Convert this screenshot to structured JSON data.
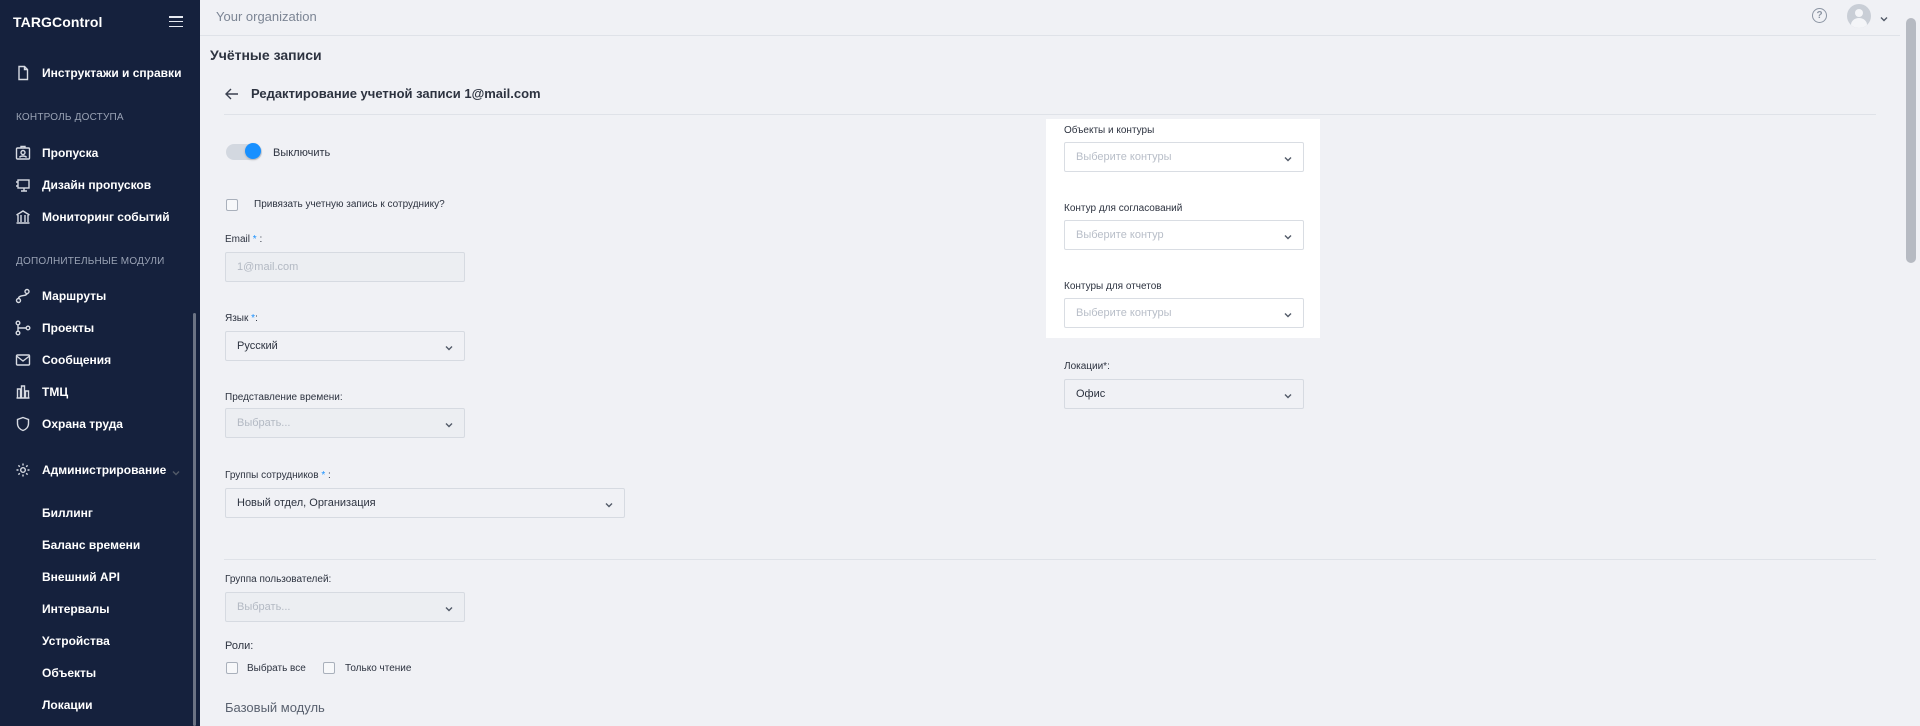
{
  "app": {
    "logo": "TARGControl"
  },
  "header": {
    "org_name": "Your organization",
    "help_glyph": "?"
  },
  "sidebar": {
    "items_top": [
      {
        "label": "Инструктажи и справки",
        "icon": "document-icon"
      }
    ],
    "section_access": "КОНТРОЛЬ ДОСТУПА",
    "items_access": [
      {
        "label": "Пропуска",
        "icon": "badge-icon"
      },
      {
        "label": "Дизайн пропусков",
        "icon": "design-icon"
      },
      {
        "label": "Мониторинг событий",
        "icon": "monitor-icon"
      }
    ],
    "section_modules": "ДОПОЛНИТЕЛЬНЫЕ МОДУЛИ",
    "items_modules": [
      {
        "label": "Маршруты",
        "icon": "route-icon"
      },
      {
        "label": "Проекты",
        "icon": "projects-icon"
      },
      {
        "label": "Сообщения",
        "icon": "mail-icon"
      },
      {
        "label": "ТМЦ",
        "icon": "inventory-icon"
      },
      {
        "label": "Охрана труда",
        "icon": "shield-icon"
      }
    ],
    "admin": {
      "label": "Администрирование",
      "icon": "gear-icon"
    },
    "admin_sub": [
      "Биллинг",
      "Баланс времени",
      "Внешний API",
      "Интервалы",
      "Устройства",
      "Объекты",
      "Локации"
    ]
  },
  "page": {
    "title": "Учётные записи",
    "edit_title": "Редактирование учетной записи 1@mail.com"
  },
  "form": {
    "toggle_label": "Выключить",
    "toggle_on": true,
    "link_employee_label": "Привязать учетную запись к сотруднику?",
    "email_label": "Email",
    "email_required": "*",
    "email_colon": " :",
    "email_value": "1@mail.com",
    "language_label": "Язык",
    "language_required": "*",
    "language_colon": ":",
    "language_value": "Русский",
    "time_label": "Представление времени:",
    "time_placeholder": "Выбрать...",
    "groups_label": "Группы сотрудников",
    "groups_required": "*",
    "groups_colon": " :",
    "groups_value": "Новый отдел, Организация",
    "user_group_label": "Группа пользователей:",
    "user_group_placeholder": "Выбрать...",
    "roles_label": "Роли:",
    "select_all_label": "Выбрать все",
    "read_only_label": "Только чтение",
    "base_module": "Базовый модуль"
  },
  "right": {
    "objects_label": "Объекты и контуры",
    "objects_placeholder": "Выберите контуры",
    "approval_label": "Контур для согласований",
    "approval_placeholder": "Выберите контур",
    "reports_label": "Контуры для отчетов",
    "reports_placeholder": "Выберите контуры",
    "locations_label": "Локации*:",
    "locations_value": "Офис"
  },
  "colors": {
    "sidebar_bg": "#15213d",
    "accent": "#1890ff",
    "page_bg": "#f0f1f5"
  }
}
